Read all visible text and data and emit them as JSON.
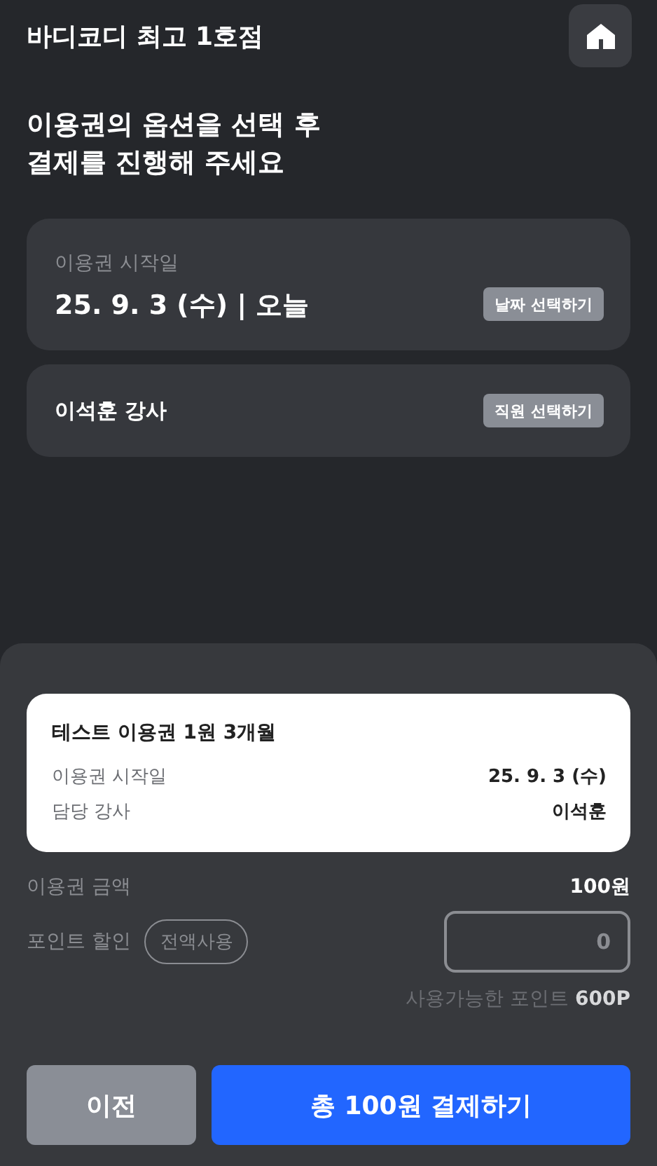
{
  "header": {
    "title": "바디코디 최고 1호점"
  },
  "heading": [
    "이용권의 옵션을 선택 후",
    "결제를 진행해 주세요"
  ],
  "options": [
    {
      "kind": "date",
      "label": "이용권 시작일",
      "value": "25. 9. 3 (수) | 오늘",
      "button": "날짜 선택하기"
    },
    {
      "kind": "staff",
      "value": "이석훈 강사",
      "button": "직원 선택하기"
    }
  ],
  "summary": {
    "title": "테스트 이용권 1원 3개월",
    "rows": [
      {
        "label": "이용권 시작일",
        "value": "25. 9. 3 (수)"
      },
      {
        "label": "담당 강사",
        "value": "이석훈"
      }
    ]
  },
  "amount": {
    "label": "이용권 금액",
    "value": "100원"
  },
  "points": {
    "label": "포인트 할인",
    "use_all_button": "전액사용",
    "value": "0",
    "available_label": "사용가능한 포인트",
    "available_value": "600P"
  },
  "buttons": {
    "back": "이전",
    "pay": "총 100원 결제하기"
  }
}
